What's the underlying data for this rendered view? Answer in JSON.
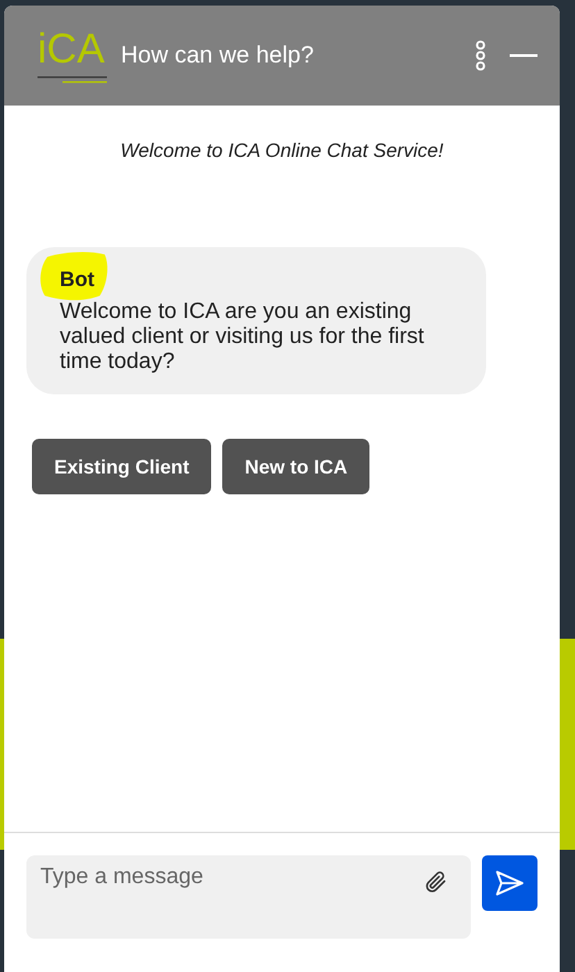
{
  "header": {
    "logo": "iCA",
    "title": "How can we help?"
  },
  "welcome": "Welcome to ICA Online Chat Service!",
  "messages": [
    {
      "sender": "Bot",
      "text": "Welcome to ICA are you an existing valued client or visiting us for the first time today?"
    }
  ],
  "quick_replies": [
    "Existing Client",
    "New to ICA"
  ],
  "composer": {
    "placeholder": "Type a message"
  }
}
